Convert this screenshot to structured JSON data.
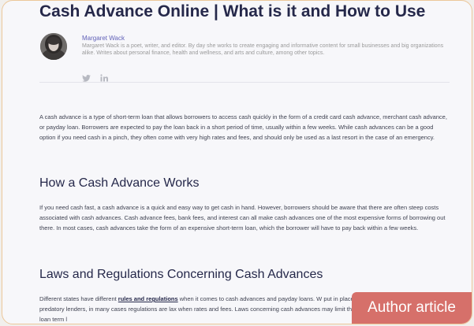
{
  "article": {
    "title": "Cash Advance Online | What is it and How to Use",
    "author": {
      "name": "Margaret Wack",
      "bio": "Margaret Wack is a poet, writer, and editor. By day she works to create engaging and informative content for small businesses and big organizations alike. Writes about personal finance, health and wellness, and arts and culture, among other topics.",
      "social": [
        "twitter-icon",
        "linkedin-icon"
      ]
    },
    "intro": "A cash advance is a type of short-term loan that allows borrowers to access cash quickly in the form of a credit card cash advance, merchant cash advance, or payday loan. Borrowers are expected to pay the loan back in a short period of time, usually within a few weeks. While cash advances can be a good option if you need cash in a pinch, they often come with very high rates and fees, and should only be used as a last resort in the case of an emergency.",
    "section1": {
      "heading": "How a Cash Advance Works",
      "body": "If you need cash fast, a cash advance is a quick and easy way to get cash in hand. However, borrowers should be aware that there are often steep costs associated with cash advances. Cash advance fees, bank fees, and interest can all make cash advances one of the most expensive forms of borrowing out there. In most cases, cash advances take the form of an expensive short-term loan, which the borrower will have to pay back within a few weeks."
    },
    "section2": {
      "heading": "Laws and Regulations Concerning Cash Advances",
      "body_before": "Different states have different ",
      "link": "rules and regulations",
      "body_after": " when it comes to cash advances and payday loans. W put in place in order to protect consumers from predatory lenders, in many cases regulations are lax when rates and fees. Laws concerning cash advances may limit the maximum loan amount, maximum loan term l"
    }
  },
  "badge": {
    "label": "Author article",
    "color": "#d6706a"
  },
  "colors": {
    "heading": "#25284a",
    "author_name": "#6161b8",
    "frame_border": "#ecc79a"
  }
}
